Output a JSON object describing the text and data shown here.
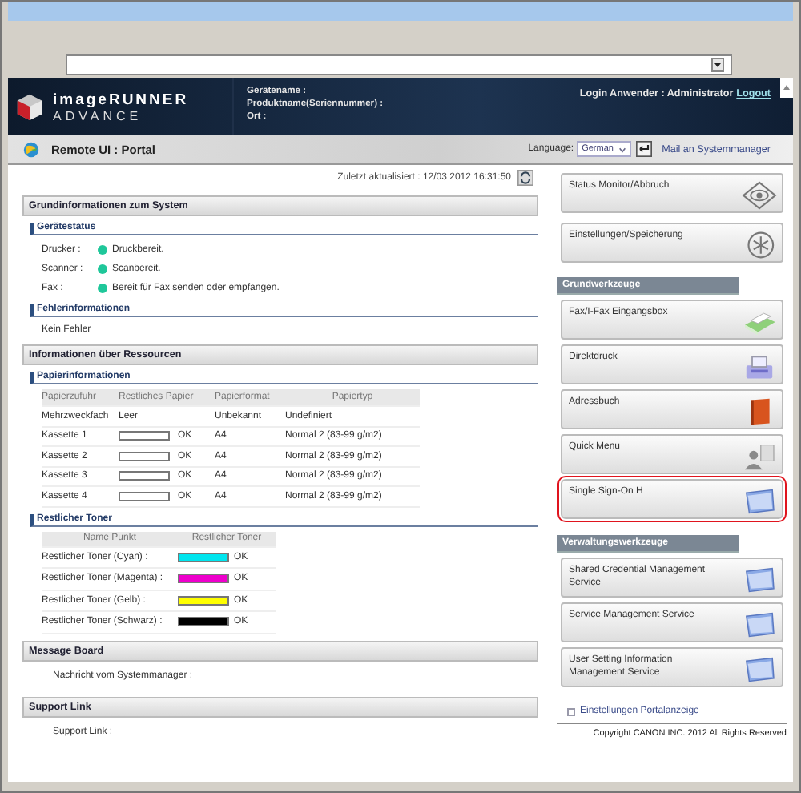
{
  "header": {
    "logo_line_1": "imageRUNNER",
    "logo_line_2": "ADVANCE",
    "fields": [
      "Gerätename :",
      "Produktname(Seriennummer) :",
      "Ort :"
    ],
    "login": "Login Anwender : Administrator",
    "logout": "Logout"
  },
  "portal_bar": {
    "title": "Remote UI : Portal",
    "language_label": "Language:",
    "language": "German",
    "mail_link": "Mail an Systemmanager"
  },
  "last_updated": "Zuletzt aktualisiert : 12/03 2012 16:31:50",
  "system": {
    "title": "Grundinformationen zum System",
    "status_title": "Gerätestatus",
    "status": [
      {
        "label": "Drucker :",
        "value": "Druckbereit.",
        "color": "#1fc79a"
      },
      {
        "label": "Scanner :",
        "value": "Scanbereit.",
        "color": "#1fc79a"
      },
      {
        "label": "Fax :",
        "value": "Bereit für Fax senden oder empfangen.",
        "color": "#1fc79a"
      }
    ],
    "error_title": "Fehlerinformationen",
    "error_text": "Kein Fehler"
  },
  "resources": {
    "title": "Informationen über Ressourcen",
    "paper_title": "Papierinformationen",
    "paper_columns": [
      "Papierzufuhr",
      "Restliches Papier",
      "Papierformat",
      "Papiertyp"
    ],
    "paper_rows": [
      {
        "source": "Mehrzweckfach",
        "remaining": "Leer",
        "bar": false,
        "format": "Unbekannt",
        "type": "Undefiniert"
      },
      {
        "source": "Kassette 1",
        "remaining": "OK",
        "bar": true,
        "format": "A4",
        "type": "Normal 2 (83-99 g/m2)"
      },
      {
        "source": "Kassette 2",
        "remaining": "OK",
        "bar": true,
        "format": "A4",
        "type": "Normal 2 (83-99 g/m2)"
      },
      {
        "source": "Kassette 3",
        "remaining": "OK",
        "bar": true,
        "format": "A4",
        "type": "Normal 2 (83-99 g/m2)"
      },
      {
        "source": "Kassette 4",
        "remaining": "OK",
        "bar": true,
        "format": "A4",
        "type": "Normal 2 (83-99 g/m2)"
      }
    ],
    "toner_title": "Restlicher Toner",
    "toner_columns": [
      "Name Punkt",
      "Restlicher Toner"
    ],
    "toner_rows": [
      {
        "name": "Restlicher Toner (Cyan) :",
        "color": "#00e5ee",
        "level": 1,
        "status": "OK"
      },
      {
        "name": "Restlicher Toner (Magenta) :",
        "color": "#ee00cc",
        "level": 1,
        "status": "OK"
      },
      {
        "name": "Restlicher Toner (Gelb) :",
        "color": "#ffff00",
        "level": 1,
        "status": "OK"
      },
      {
        "name": "Restlicher Toner (Schwarz) :",
        "color": "#000000",
        "level": 1,
        "status": "OK"
      }
    ]
  },
  "message_board": {
    "title": "Message Board",
    "text": "Nachricht vom Systemmanager :"
  },
  "support": {
    "title": "Support Link",
    "text": "Support Link :"
  },
  "sidebar": {
    "top": [
      {
        "label": "Status Monitor/Abbruch",
        "kind": "eye",
        "selected": false
      },
      {
        "label": "Einstellungen/Speicherung",
        "kind": "gear",
        "selected": false
      }
    ],
    "groups": [
      {
        "title": "Grundwerkzeuge",
        "items": [
          {
            "label": "Fax/I-Fax Eingangsbox",
            "kind": "fax",
            "selected": false
          },
          {
            "label": "Direktdruck",
            "kind": "printer",
            "selected": false
          },
          {
            "label": "Adressbuch",
            "kind": "book",
            "selected": false
          },
          {
            "label": "Quick Menu",
            "kind": "person",
            "selected": false
          },
          {
            "label": "Single Sign-On H",
            "kind": "window",
            "selected": true
          }
        ]
      },
      {
        "title": "Verwaltungswerkzeuge",
        "items": [
          {
            "label": "Shared Credential Management Service",
            "kind": "window",
            "selected": false
          },
          {
            "label": "Service Management Service",
            "kind": "window",
            "selected": false
          },
          {
            "label": "User Setting Information Management Service",
            "kind": "window",
            "selected": false
          }
        ]
      }
    ],
    "settings_link": "Einstellungen Portalanzeige"
  },
  "copyright": "Copyright CANON INC. 2012 All Rights Reserved"
}
